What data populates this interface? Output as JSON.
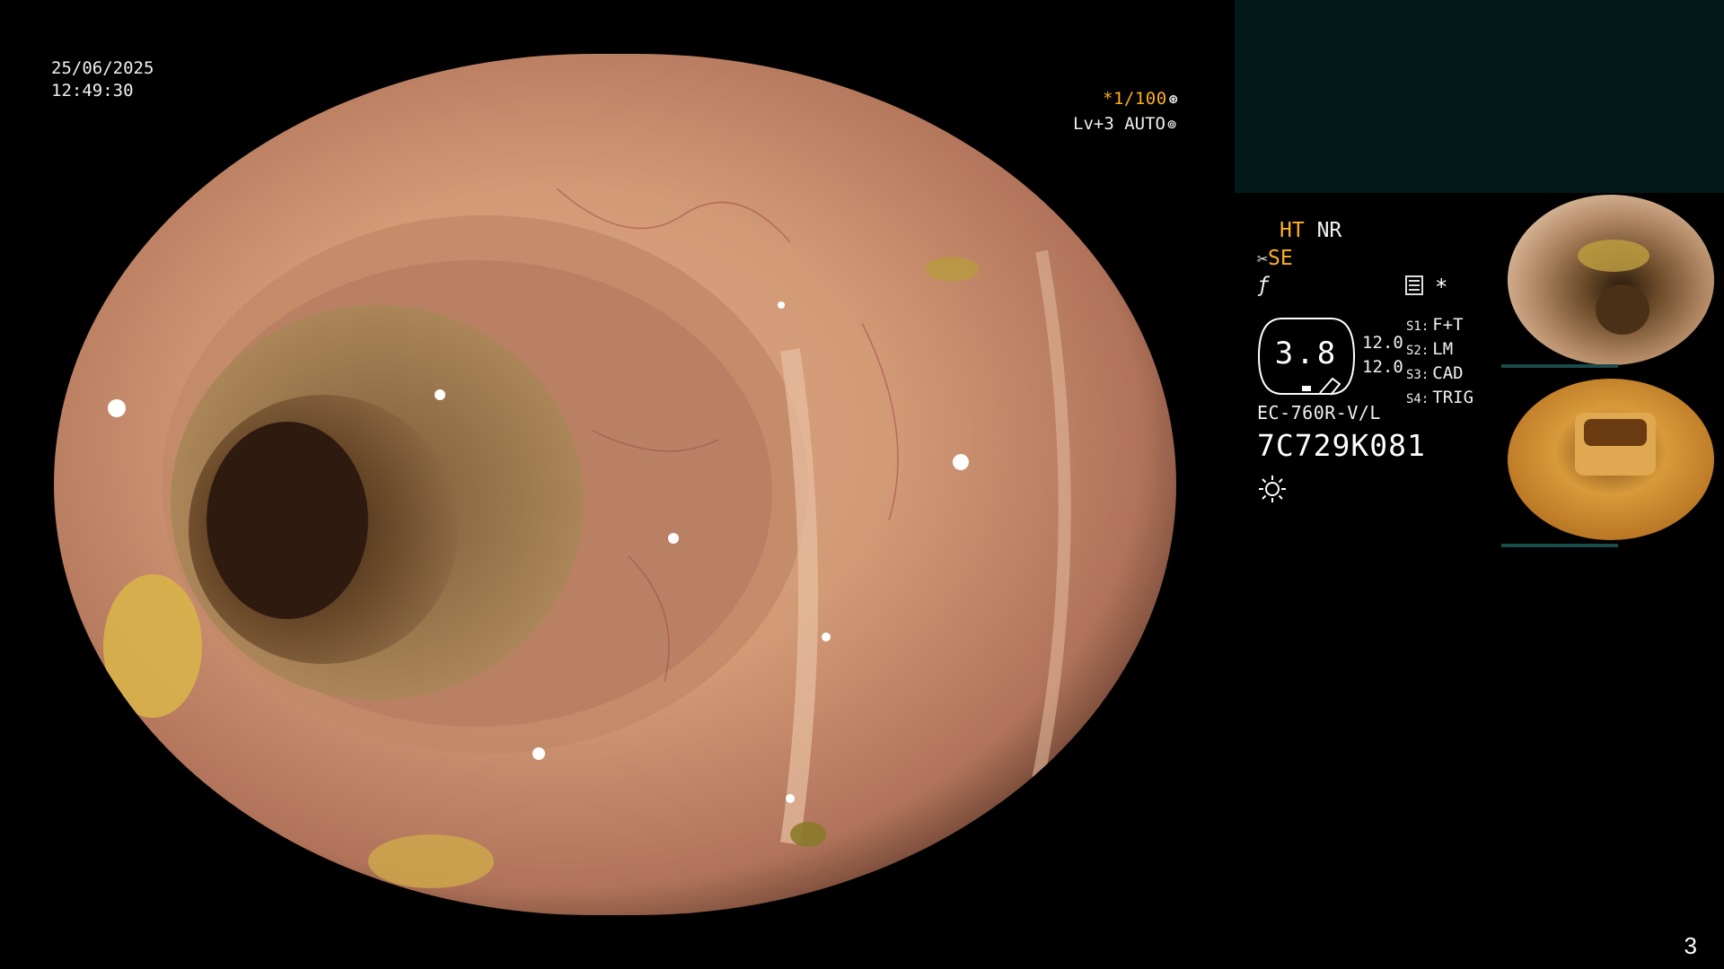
{
  "overlay": {
    "date": "25/06/2025",
    "time": "12:49:30",
    "shutter": "*1/100",
    "level": "Lv+3 AUTO"
  },
  "panel": {
    "mode_ht": "HT",
    "mode_nr": "NR",
    "mode_se": "SE",
    "gauge_value": "3.8",
    "gauge_side_top": "12.0",
    "gauge_side_bottom": "12.0",
    "switches": [
      {
        "key": "S1:",
        "value": "F+T"
      },
      {
        "key": "S2:",
        "value": "LM"
      },
      {
        "key": "S3:",
        "value": "CAD"
      },
      {
        "key": "S4:",
        "value": "TRIG"
      }
    ],
    "scope_model": "EC-760R-V/L",
    "scope_serial": "7C729K081",
    "accent_color": "#ffb01f"
  },
  "icons": [
    "aperture-icon",
    "iris-icon",
    "scissors-icon",
    "squiggle-icon",
    "menu-icon",
    "star-icon",
    "light-icon"
  ],
  "page_number": "3"
}
